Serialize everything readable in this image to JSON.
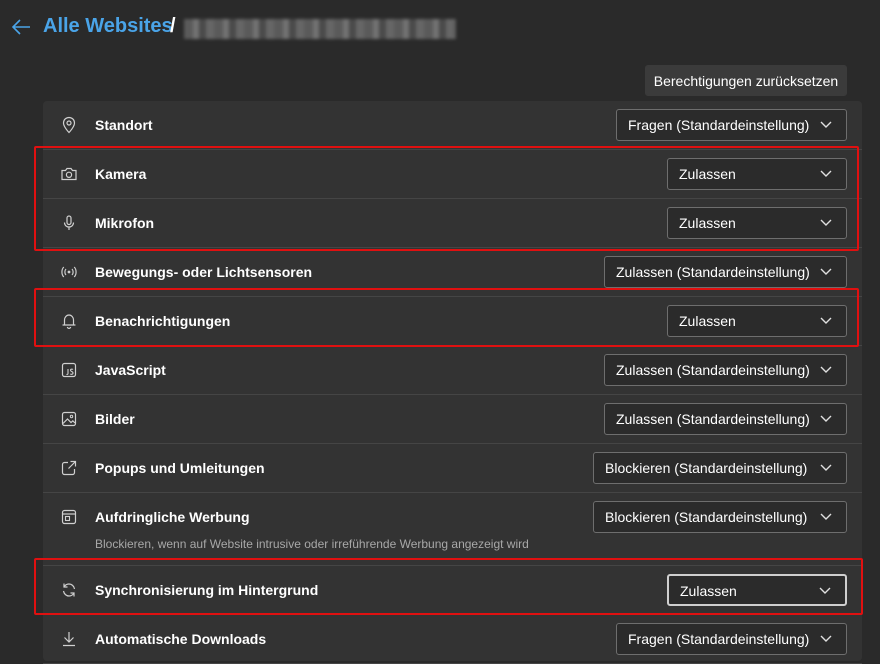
{
  "header": {
    "breadcrumb_link": "Alle Websites",
    "separator": "/"
  },
  "reset_button": "Berechtigungen zurücksetzen",
  "permissions": [
    {
      "icon": "location-pin-icon",
      "label": "Standort",
      "value": "Fragen (Standardeinstellung)"
    },
    {
      "icon": "camera-icon",
      "label": "Kamera",
      "value": "Zulassen"
    },
    {
      "icon": "microphone-icon",
      "label": "Mikrofon",
      "value": "Zulassen"
    },
    {
      "icon": "sensor-icon",
      "label": "Bewegungs- oder Lichtsensoren",
      "value": "Zulassen (Standardeinstellung)"
    },
    {
      "icon": "bell-icon",
      "label": "Benachrichtigungen",
      "value": "Zulassen"
    },
    {
      "icon": "javascript-icon",
      "label": "JavaScript",
      "value": "Zulassen (Standardeinstellung)"
    },
    {
      "icon": "image-icon",
      "label": "Bilder",
      "value": "Zulassen (Standardeinstellung)"
    },
    {
      "icon": "popup-icon",
      "label": "Popups und Umleitungen",
      "value": "Blockieren (Standardeinstellung)"
    },
    {
      "icon": "ad-icon",
      "label": "Aufdringliche Werbung",
      "value": "Blockieren (Standardeinstellung)",
      "description": "Blockieren, wenn auf Website intrusive oder irreführende Werbung angezeigt wird"
    },
    {
      "icon": "sync-icon",
      "label": "Synchronisierung im Hintergrund",
      "value": "Zulassen"
    },
    {
      "icon": "download-icon",
      "label": "Automatische Downloads",
      "value": "Fragen (Standardeinstellung)"
    }
  ],
  "colors": {
    "background": "#2a2a2a",
    "panel": "#333333",
    "accent_link": "#4aa4e8",
    "highlight": "#e01010"
  }
}
